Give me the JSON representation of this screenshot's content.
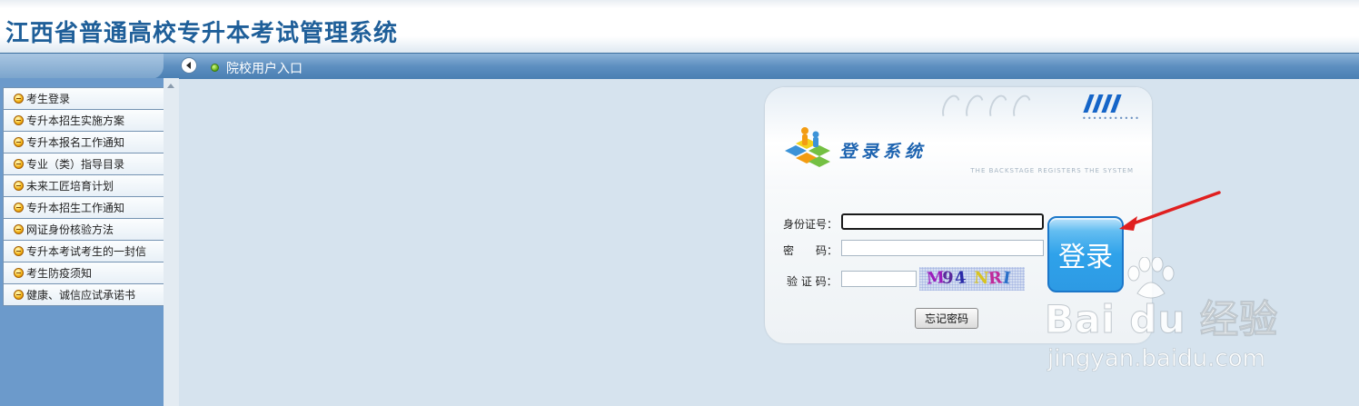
{
  "header": {
    "title": "江西省普通高校专升本考试管理系统"
  },
  "nav": {
    "link_label": "院校用户入口"
  },
  "sidebar": {
    "items": [
      {
        "label": "考生登录"
      },
      {
        "label": "专升本招生实施方案"
      },
      {
        "label": "专升本报名工作通知"
      },
      {
        "label": "专业（类）指导目录"
      },
      {
        "label": "未来工匠培育计划"
      },
      {
        "label": "专升本招生工作通知"
      },
      {
        "label": "网证身份核验方法"
      },
      {
        "label": "专升本考试考生的一封信"
      },
      {
        "label": "考生防疫须知"
      },
      {
        "label": "健康、诚信应试承诺书"
      }
    ]
  },
  "login": {
    "heading": "登录系统",
    "subheading": "THE BACKSTAGE REGISTERS THE SYSTEM",
    "id_label": "身份证号：",
    "id_value": "",
    "password_label": "密　　码：",
    "password_value": "",
    "captcha_label": "验 证 码：",
    "captcha_value": "",
    "captcha_text": [
      "M",
      "9",
      "4",
      "N",
      "R",
      "I"
    ],
    "login_button": "登录",
    "forgot_button": "忘记密码"
  },
  "watermark": {
    "main_text": "Bai du 经验",
    "url_text": "jingyan.baidu.com"
  },
  "colors": {
    "title": "#1f5f99",
    "nav_bar": "#5d8fc0",
    "sidebar": "#6c9acb",
    "content_bg": "#d6e3ee",
    "login_button": "#2fa2ea",
    "annotation_arrow": "#e02020"
  }
}
